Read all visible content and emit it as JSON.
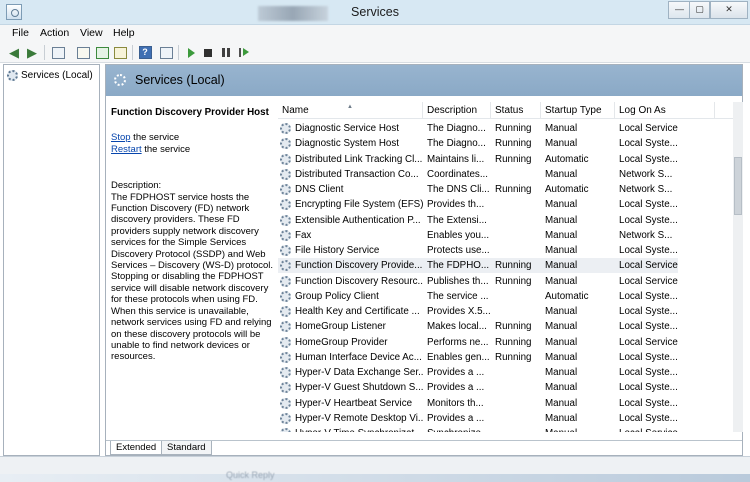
{
  "window": {
    "title": "Services",
    "controls": {
      "minimize": "—",
      "maximize": "▢",
      "close": "✕"
    }
  },
  "menu": [
    "File",
    "Action",
    "View",
    "Help"
  ],
  "toolbar": {
    "icons": [
      "back-arrow",
      "forward-arrow",
      "show-hide-console-tree",
      "properties",
      "refresh",
      "export-list",
      "help",
      "console-view",
      "start-service",
      "stop-service",
      "pause-service",
      "restart-service"
    ]
  },
  "tree": {
    "item": "Services (Local)"
  },
  "pane": {
    "header": "Services (Local)"
  },
  "details": {
    "service_name": "Function Discovery Provider Host",
    "stop_link": "Stop",
    "stop_rest": " the service",
    "restart_link": "Restart",
    "restart_rest": " the service",
    "description_label": "Description:",
    "description": "The FDPHOST service hosts the Function Discovery (FD) network discovery providers. These FD providers supply network discovery services for the Simple Services Discovery Protocol (SSDP) and Web Services – Discovery (WS-D) protocol. Stopping or disabling the FDPHOST service will disable network discovery for these protocols when using FD. When this service is unavailable, network services using FD and relying on these discovery protocols will be unable to find network devices or resources."
  },
  "list": {
    "columns": [
      "Name",
      "Description",
      "Status",
      "Startup Type",
      "Log On As"
    ],
    "sorted_column": "Name",
    "selected_row": "Function Discovery Provide...",
    "rows": [
      [
        "Diagnostic Service Host",
        "The Diagno...",
        "Running",
        "Manual",
        "Local Service"
      ],
      [
        "Diagnostic System Host",
        "The Diagno...",
        "Running",
        "Manual",
        "Local Syste..."
      ],
      [
        "Distributed Link Tracking Cl...",
        "Maintains li...",
        "Running",
        "Automatic",
        "Local Syste..."
      ],
      [
        "Distributed Transaction Co...",
        "Coordinates...",
        "",
        "Manual",
        "Network S..."
      ],
      [
        "DNS Client",
        "The DNS Cli...",
        "Running",
        "Automatic",
        "Network S..."
      ],
      [
        "Encrypting File System (EFS)",
        "Provides th...",
        "",
        "Manual",
        "Local Syste..."
      ],
      [
        "Extensible Authentication P...",
        "The Extensi...",
        "",
        "Manual",
        "Local Syste..."
      ],
      [
        "Fax",
        "Enables you...",
        "",
        "Manual",
        "Network S..."
      ],
      [
        "File History Service",
        "Protects use...",
        "",
        "Manual",
        "Local Syste..."
      ],
      [
        "Function Discovery Provide...",
        "The FDPHO...",
        "Running",
        "Manual",
        "Local Service"
      ],
      [
        "Function Discovery Resourc...",
        "Publishes th...",
        "Running",
        "Manual",
        "Local Service"
      ],
      [
        "Group Policy Client",
        "The service ...",
        "",
        "Automatic",
        "Local Syste..."
      ],
      [
        "Health Key and Certificate ...",
        "Provides X.5...",
        "",
        "Manual",
        "Local Syste..."
      ],
      [
        "HomeGroup Listener",
        "Makes local...",
        "Running",
        "Manual",
        "Local Syste..."
      ],
      [
        "HomeGroup Provider",
        "Performs ne...",
        "Running",
        "Manual",
        "Local Service"
      ],
      [
        "Human Interface Device Ac...",
        "Enables gen...",
        "Running",
        "Manual",
        "Local Syste..."
      ],
      [
        "Hyper-V Data Exchange Ser...",
        "Provides a ...",
        "",
        "Manual",
        "Local Syste..."
      ],
      [
        "Hyper-V Guest Shutdown S...",
        "Provides a ...",
        "",
        "Manual",
        "Local Syste..."
      ],
      [
        "Hyper-V Heartbeat Service",
        "Monitors th...",
        "",
        "Manual",
        "Local Syste..."
      ],
      [
        "Hyper-V Remote Desktop Vi...",
        "Provides a ...",
        "",
        "Manual",
        "Local Syste..."
      ],
      [
        "Hyper-V Time Synchronizat...",
        "Synchronize...",
        "",
        "Manual",
        "Local Service"
      ]
    ]
  },
  "tabs": [
    "Extended",
    "Standard"
  ],
  "active_tab": "Extended",
  "footer": {
    "partial_text": "Quick Reply"
  }
}
